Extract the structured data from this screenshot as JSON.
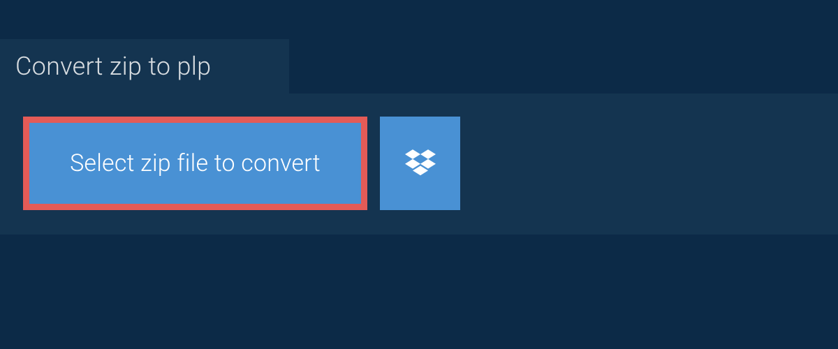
{
  "header": {
    "title": "Convert zip to plp"
  },
  "actions": {
    "select_file_label": "Select zip file to convert"
  },
  "colors": {
    "page_bg": "#0c2a47",
    "panel_bg": "#143450",
    "button_bg": "#4991d4",
    "highlight_border": "#e45b57",
    "text_light": "#d8dde1",
    "text_white": "#ffffff"
  }
}
